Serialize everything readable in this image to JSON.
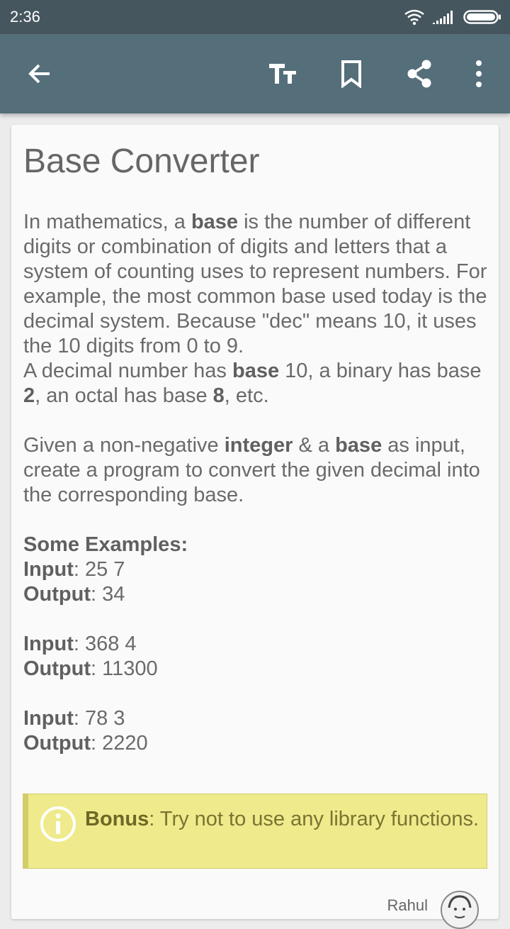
{
  "status_bar": {
    "time": "2:36"
  },
  "toolbar": {
    "back_icon": "arrow-left-icon",
    "text_size_icon": "text-size-icon",
    "bookmark_icon": "bookmark-icon",
    "share_icon": "share-icon",
    "more_icon": "more-vertical-icon"
  },
  "article": {
    "title": "Base Converter",
    "p1": {
      "a": "In mathematics, a ",
      "b_base": "base",
      "c": " is the number of different digits or combination of digits and letters that a system of counting uses to represent numbers. For example, the most common base used today is the decimal system. Because \"dec\" means 10, it uses the 10 digits from 0 to 9."
    },
    "p2": {
      "a": "A decimal number has ",
      "b_base": "base",
      "c": " 10, a binary has base ",
      "b_2": "2",
      "d": ", an octal has base ",
      "b_8": "8",
      "e": ", etc."
    },
    "p3": {
      "a": "Given a non-negative ",
      "b_integer": "integer",
      "c": " & a ",
      "b_base": "base",
      "d": " as input, create a program to convert the given decimal into the corresponding base."
    },
    "examples_heading": "Some Examples:",
    "input_label": "Input",
    "output_label": "Output",
    "examples": [
      {
        "input": ": 25 7",
        "output": ": 34"
      },
      {
        "input": ": 368 4",
        "output": ": 11300"
      },
      {
        "input": ": 78 3",
        "output": ": 2220"
      }
    ],
    "bonus": {
      "label": "Bonus",
      "text": ": Try not to use any library functions."
    },
    "author": "Rahul"
  },
  "colors": {
    "status_bar": "#46565f",
    "app_bar": "#546e7a",
    "bonus_bg": "#efea8c",
    "bonus_border": "#d2cc6a"
  }
}
